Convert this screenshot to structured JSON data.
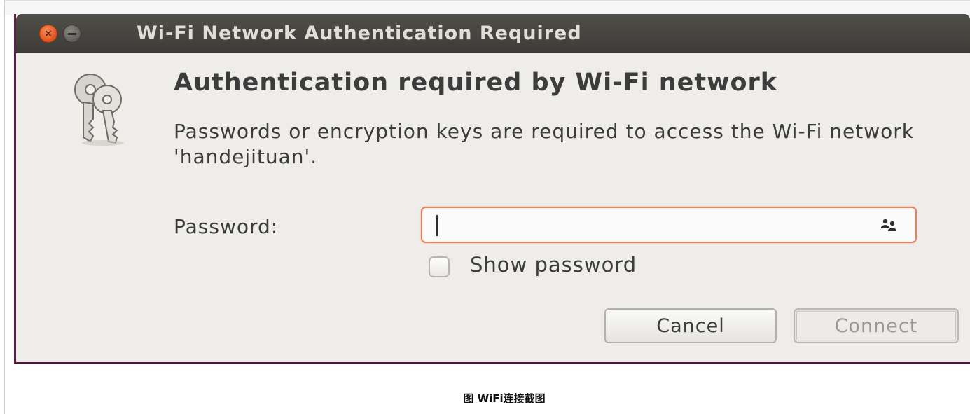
{
  "window": {
    "title": "Wi-Fi Network Authentication Required",
    "close_glyph": "×",
    "icons": {
      "close": "close-icon",
      "minimize": "minimize-icon",
      "keys": "keys-icon",
      "users": "users-icon"
    }
  },
  "dialog": {
    "heading": "Authentication required by Wi-Fi network",
    "description": "Passwords or encryption keys are required to access the Wi-Fi network 'handejituan'.",
    "password_label": "Password:",
    "password_value": "",
    "show_password_label": "Show password",
    "show_password_checked": false,
    "cancel_label": "Cancel",
    "connect_label": "Connect"
  },
  "caption": "图 WiFi连接截图",
  "colors": {
    "titlebar": "#3c3b37",
    "close_button": "#e0511c",
    "input_focus_border": "#e9825c",
    "dialog_background": "#efedea",
    "window_border": "#5b1e45"
  }
}
